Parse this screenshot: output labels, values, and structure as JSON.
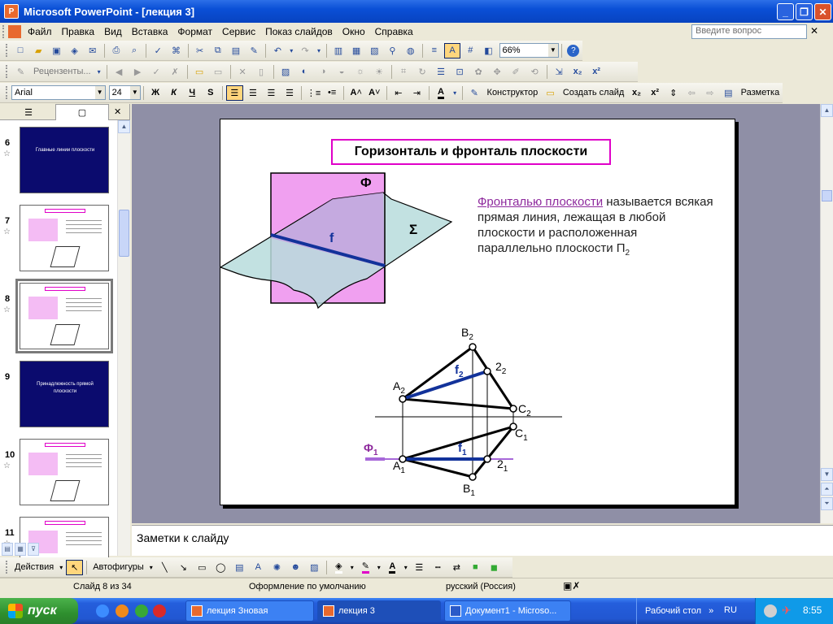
{
  "window": {
    "title": "Microsoft PowerPoint - [лекция 3]",
    "app_icon": "P"
  },
  "menu": {
    "items": [
      "Файл",
      "Правка",
      "Вид",
      "Вставка",
      "Формат",
      "Сервис",
      "Показ слайдов",
      "Окно",
      "Справка"
    ],
    "question_placeholder": "Введите вопрос"
  },
  "toolbar1": {
    "zoom": "66%"
  },
  "toolbar2": {
    "reviewers": "Рецензенты..."
  },
  "toolbar3": {
    "font": "Arial",
    "size": "24",
    "bold": "Ж",
    "italic": "К",
    "underline": "Ч",
    "shadow": "S",
    "designer": "Конструктор",
    "new_slide": "Создать слайд",
    "layout": "Разметка"
  },
  "leftpane": {
    "thumbs": [
      {
        "num": "6",
        "text": "Главные линии плоскости"
      },
      {
        "num": "7",
        "text": ""
      },
      {
        "num": "8",
        "text": ""
      },
      {
        "num": "9",
        "text": "Принадлежность прямой плоскости"
      },
      {
        "num": "10",
        "text": ""
      },
      {
        "num": "11",
        "text": ""
      }
    ]
  },
  "slide": {
    "title": "Горизонталь и фронталь плоскости",
    "definition_term": "Фронталью плоскости",
    "definition_rest": " называется всякая прямая линия, лежащая в любой плоскости и расположенная параллельно плоскости П",
    "definition_sub": "2",
    "plane_phi": "Ф",
    "plane_sigma": "Σ",
    "line_f": "f",
    "labels": {
      "B2": "B",
      "B2s": "2",
      "n22": "2",
      "n22s": "2",
      "A2": "A",
      "A2s": "2",
      "C2": "C",
      "C2s": "2",
      "C1": "C",
      "C1s": "1",
      "A1": "A",
      "A1s": "1",
      "n21": "2",
      "n21s": "1",
      "B1": "B",
      "B1s": "1",
      "f2": "f",
      "f2s": "2",
      "f1": "f",
      "f1s": "1",
      "phi1": "Ф",
      "phi1s": "1"
    }
  },
  "notes": "Заметки к слайду",
  "drawbar": {
    "actions": "Действия",
    "autoshapes": "Автофигуры"
  },
  "status": {
    "slide": "Слайд 8 из 34",
    "design": "Оформление по умолчанию",
    "lang": "русский (Россия)"
  },
  "taskbar": {
    "start": "пуск",
    "tasks": [
      "лекция Зновая",
      "лекция 3",
      "Документ1 - Microso..."
    ],
    "desktop": "Рабочий стол",
    "lang": "RU",
    "clock": "8:55"
  },
  "colors": {
    "accent": "#e000c8",
    "frontal_line": "#12329a",
    "plane_phi": "#f0a0f0",
    "plane_sigma": "#b7dcdc"
  }
}
